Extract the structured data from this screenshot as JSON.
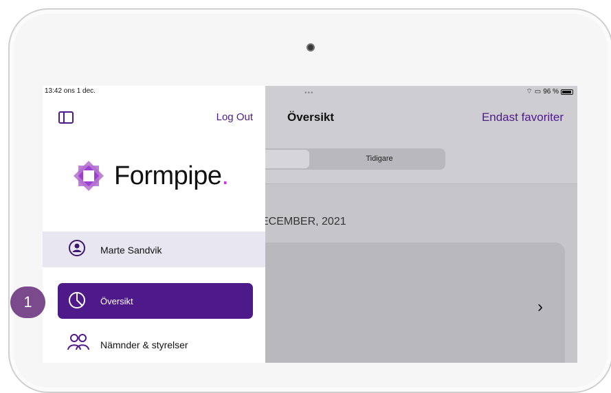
{
  "status": {
    "time": "13:42  ons 1 dec.",
    "battery": "96 %",
    "dots": "•••"
  },
  "sidebar": {
    "logout": "Log Out",
    "logo_text": "Formpipe",
    "logo_dot": ".",
    "user_name": "Marte Sandvik",
    "items": [
      {
        "label": "Översikt",
        "active": true,
        "icon": "pie-chart-icon"
      },
      {
        "label": "Nämnder & styrelser",
        "active": false,
        "icon": "people-icon"
      }
    ]
  },
  "main": {
    "title": "Översikt",
    "favorites_link": "Endast favoriter",
    "segment_right": "Tidigare",
    "date_header": "ECEMBER, 2021"
  },
  "callout": {
    "number": "1"
  },
  "colors": {
    "accent": "#4e1a8a",
    "logo_magenta": "#c93bd4",
    "user_row_bg": "#e7e6f1"
  }
}
